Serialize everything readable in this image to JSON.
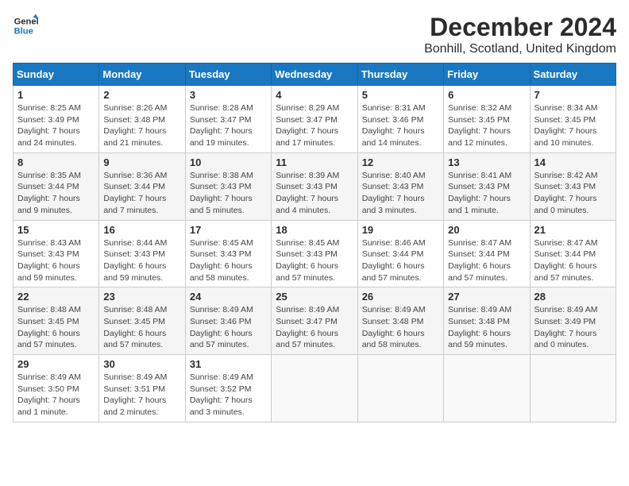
{
  "logo": {
    "line1": "General",
    "line2": "Blue"
  },
  "title": "December 2024",
  "location": "Bonhill, Scotland, United Kingdom",
  "days_header": [
    "Sunday",
    "Monday",
    "Tuesday",
    "Wednesday",
    "Thursday",
    "Friday",
    "Saturday"
  ],
  "weeks": [
    [
      {
        "day": "1",
        "sunrise": "Sunrise: 8:25 AM",
        "sunset": "Sunset: 3:49 PM",
        "daylight": "Daylight: 7 hours and 24 minutes."
      },
      {
        "day": "2",
        "sunrise": "Sunrise: 8:26 AM",
        "sunset": "Sunset: 3:48 PM",
        "daylight": "Daylight: 7 hours and 21 minutes."
      },
      {
        "day": "3",
        "sunrise": "Sunrise: 8:28 AM",
        "sunset": "Sunset: 3:47 PM",
        "daylight": "Daylight: 7 hours and 19 minutes."
      },
      {
        "day": "4",
        "sunrise": "Sunrise: 8:29 AM",
        "sunset": "Sunset: 3:47 PM",
        "daylight": "Daylight: 7 hours and 17 minutes."
      },
      {
        "day": "5",
        "sunrise": "Sunrise: 8:31 AM",
        "sunset": "Sunset: 3:46 PM",
        "daylight": "Daylight: 7 hours and 14 minutes."
      },
      {
        "day": "6",
        "sunrise": "Sunrise: 8:32 AM",
        "sunset": "Sunset: 3:45 PM",
        "daylight": "Daylight: 7 hours and 12 minutes."
      },
      {
        "day": "7",
        "sunrise": "Sunrise: 8:34 AM",
        "sunset": "Sunset: 3:45 PM",
        "daylight": "Daylight: 7 hours and 10 minutes."
      }
    ],
    [
      {
        "day": "8",
        "sunrise": "Sunrise: 8:35 AM",
        "sunset": "Sunset: 3:44 PM",
        "daylight": "Daylight: 7 hours and 9 minutes."
      },
      {
        "day": "9",
        "sunrise": "Sunrise: 8:36 AM",
        "sunset": "Sunset: 3:44 PM",
        "daylight": "Daylight: 7 hours and 7 minutes."
      },
      {
        "day": "10",
        "sunrise": "Sunrise: 8:38 AM",
        "sunset": "Sunset: 3:43 PM",
        "daylight": "Daylight: 7 hours and 5 minutes."
      },
      {
        "day": "11",
        "sunrise": "Sunrise: 8:39 AM",
        "sunset": "Sunset: 3:43 PM",
        "daylight": "Daylight: 7 hours and 4 minutes."
      },
      {
        "day": "12",
        "sunrise": "Sunrise: 8:40 AM",
        "sunset": "Sunset: 3:43 PM",
        "daylight": "Daylight: 7 hours and 3 minutes."
      },
      {
        "day": "13",
        "sunrise": "Sunrise: 8:41 AM",
        "sunset": "Sunset: 3:43 PM",
        "daylight": "Daylight: 7 hours and 1 minute."
      },
      {
        "day": "14",
        "sunrise": "Sunrise: 8:42 AM",
        "sunset": "Sunset: 3:43 PM",
        "daylight": "Daylight: 7 hours and 0 minutes."
      }
    ],
    [
      {
        "day": "15",
        "sunrise": "Sunrise: 8:43 AM",
        "sunset": "Sunset: 3:43 PM",
        "daylight": "Daylight: 6 hours and 59 minutes."
      },
      {
        "day": "16",
        "sunrise": "Sunrise: 8:44 AM",
        "sunset": "Sunset: 3:43 PM",
        "daylight": "Daylight: 6 hours and 59 minutes."
      },
      {
        "day": "17",
        "sunrise": "Sunrise: 8:45 AM",
        "sunset": "Sunset: 3:43 PM",
        "daylight": "Daylight: 6 hours and 58 minutes."
      },
      {
        "day": "18",
        "sunrise": "Sunrise: 8:45 AM",
        "sunset": "Sunset: 3:43 PM",
        "daylight": "Daylight: 6 hours and 57 minutes."
      },
      {
        "day": "19",
        "sunrise": "Sunrise: 8:46 AM",
        "sunset": "Sunset: 3:44 PM",
        "daylight": "Daylight: 6 hours and 57 minutes."
      },
      {
        "day": "20",
        "sunrise": "Sunrise: 8:47 AM",
        "sunset": "Sunset: 3:44 PM",
        "daylight": "Daylight: 6 hours and 57 minutes."
      },
      {
        "day": "21",
        "sunrise": "Sunrise: 8:47 AM",
        "sunset": "Sunset: 3:44 PM",
        "daylight": "Daylight: 6 hours and 57 minutes."
      }
    ],
    [
      {
        "day": "22",
        "sunrise": "Sunrise: 8:48 AM",
        "sunset": "Sunset: 3:45 PM",
        "daylight": "Daylight: 6 hours and 57 minutes."
      },
      {
        "day": "23",
        "sunrise": "Sunrise: 8:48 AM",
        "sunset": "Sunset: 3:45 PM",
        "daylight": "Daylight: 6 hours and 57 minutes."
      },
      {
        "day": "24",
        "sunrise": "Sunrise: 8:49 AM",
        "sunset": "Sunset: 3:46 PM",
        "daylight": "Daylight: 6 hours and 57 minutes."
      },
      {
        "day": "25",
        "sunrise": "Sunrise: 8:49 AM",
        "sunset": "Sunset: 3:47 PM",
        "daylight": "Daylight: 6 hours and 57 minutes."
      },
      {
        "day": "26",
        "sunrise": "Sunrise: 8:49 AM",
        "sunset": "Sunset: 3:48 PM",
        "daylight": "Daylight: 6 hours and 58 minutes."
      },
      {
        "day": "27",
        "sunrise": "Sunrise: 8:49 AM",
        "sunset": "Sunset: 3:48 PM",
        "daylight": "Daylight: 6 hours and 59 minutes."
      },
      {
        "day": "28",
        "sunrise": "Sunrise: 8:49 AM",
        "sunset": "Sunset: 3:49 PM",
        "daylight": "Daylight: 7 hours and 0 minutes."
      }
    ],
    [
      {
        "day": "29",
        "sunrise": "Sunrise: 8:49 AM",
        "sunset": "Sunset: 3:50 PM",
        "daylight": "Daylight: 7 hours and 1 minute."
      },
      {
        "day": "30",
        "sunrise": "Sunrise: 8:49 AM",
        "sunset": "Sunset: 3:51 PM",
        "daylight": "Daylight: 7 hours and 2 minutes."
      },
      {
        "day": "31",
        "sunrise": "Sunrise: 8:49 AM",
        "sunset": "Sunset: 3:52 PM",
        "daylight": "Daylight: 7 hours and 3 minutes."
      },
      null,
      null,
      null,
      null
    ]
  ]
}
